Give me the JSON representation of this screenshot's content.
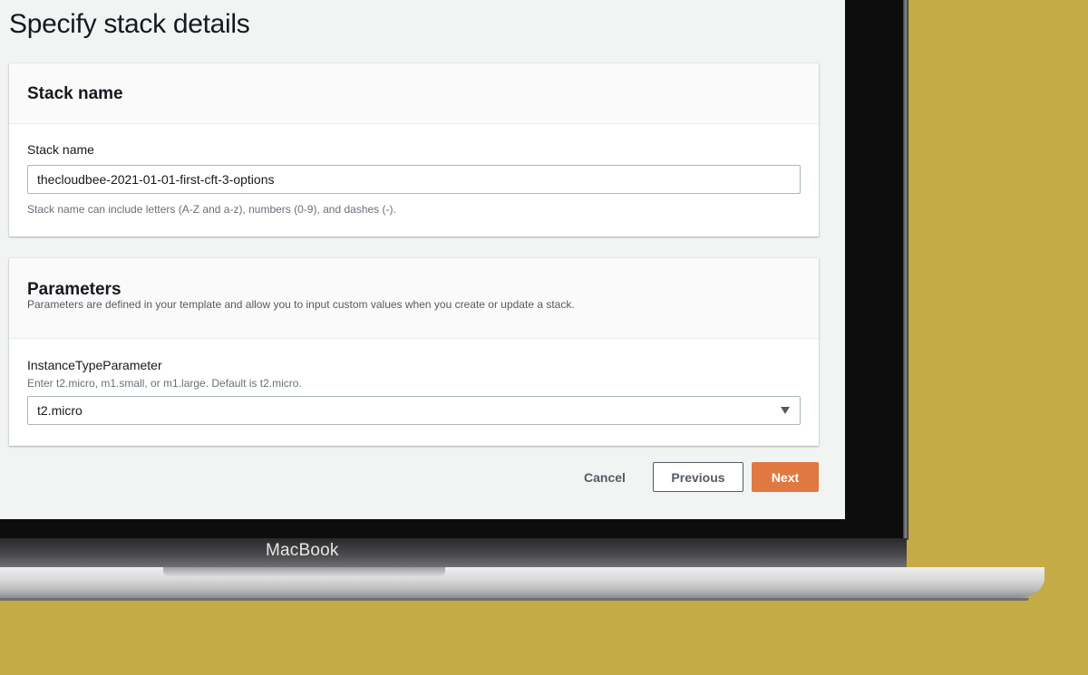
{
  "page": {
    "title": "Specify stack details"
  },
  "stack_name_section": {
    "title": "Stack name",
    "field_label": "Stack name",
    "value": "thecloudbee-2021-01-01-first-cft-3-options",
    "hint": "Stack name can include letters (A-Z and a-z), numbers (0-9), and dashes (-)."
  },
  "parameters_section": {
    "title": "Parameters",
    "description": "Parameters are defined in your template and allow you to input custom values when you create or update a stack.",
    "param_label": "InstanceTypeParameter",
    "param_desc": "Enter t2.micro, m1.small, or m1.large. Default is t2.micro.",
    "selected_value": "t2.micro"
  },
  "actions": {
    "cancel": "Cancel",
    "previous": "Previous",
    "next": "Next"
  },
  "device": {
    "brand": "MacBook"
  },
  "colors": {
    "primary_button": "#e07941",
    "background": "#c4ab45"
  },
  "icons": {
    "select_caret": "caret-down-icon"
  }
}
